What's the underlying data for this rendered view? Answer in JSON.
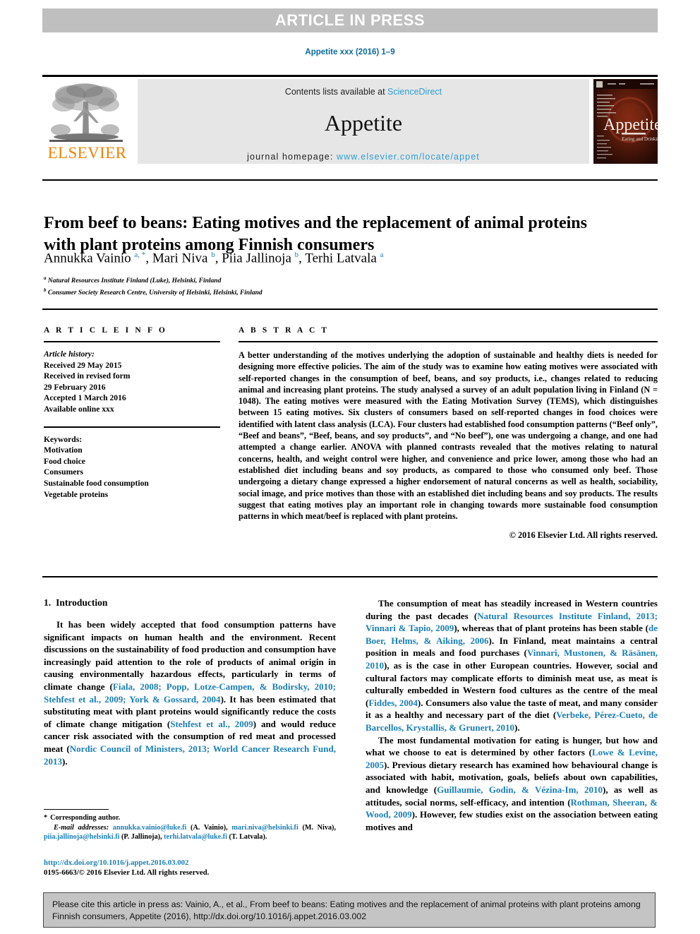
{
  "banner": {
    "label": "ARTICLE IN PRESS"
  },
  "running_head": "Appetite xxx (2016) 1–9",
  "journal_header": {
    "contents_prefix": "Contents lists available at ",
    "sciencedirect": "ScienceDirect",
    "journal_name": "Appetite",
    "homepage_prefix": "journal homepage: ",
    "homepage_url": "www.elsevier.com/locate/appet",
    "publisher": "ELSEVIER",
    "cover_title": "Appetite",
    "cover_subtitle": "Eating and Drinking"
  },
  "article": {
    "title": "From beef to beans: Eating motives and the replacement of animal proteins with plant proteins among Finnish consumers",
    "authors": [
      {
        "name": "Annukka Vainio",
        "marks": "a, *"
      },
      {
        "name": "Mari Niva",
        "marks": "b"
      },
      {
        "name": "Piia Jallinoja",
        "marks": "b"
      },
      {
        "name": "Terhi Latvala",
        "marks": "a"
      }
    ],
    "affiliations": [
      {
        "mark": "a",
        "text": "Natural Resources Institute Finland (Luke), Helsinki, Finland"
      },
      {
        "mark": "b",
        "text": "Consumer Society Research Centre, University of Helsinki, Helsinki, Finland"
      }
    ]
  },
  "article_info": {
    "heading": "A R T I C L E  I N F O",
    "history_label": "Article history:",
    "history": [
      "Received 29 May 2015",
      "Received in revised form",
      "29 February 2016",
      "Accepted 1 March 2016",
      "Available online xxx"
    ],
    "keywords_label": "Keywords:",
    "keywords": [
      "Motivation",
      "Food choice",
      "Consumers",
      "Sustainable food consumption",
      "Vegetable proteins"
    ]
  },
  "abstract": {
    "heading": "A B S T R A C T",
    "text": "A better understanding of the motives underlying the adoption of sustainable and healthy diets is needed for designing more effective policies. The aim of the study was to examine how eating motives were associated with self-reported changes in the consumption of beef, beans, and soy products, i.e., changes related to reducing animal and increasing plant proteins. The study analysed a survey of an adult population living in Finland (N = 1048). The eating motives were measured with the Eating Motivation Survey (TEMS), which distinguishes between 15 eating motives. Six clusters of consumers based on self-reported changes in food choices were identified with latent class analysis (LCA). Four clusters had established food consumption patterns (“Beef only”, “Beef and beans”, “Beef, beans, and soy products”, and “No beef”), one was undergoing a change, and one had attempted a change earlier. ANOVA with planned contrasts revealed that the motives relating to natural concerns, health, and weight control were higher, and convenience and price lower, among those who had an established diet including beans and soy products, as compared to those who consumed only beef. Those undergoing a dietary change expressed a higher endorsement of natural concerns as well as health, sociability, social image, and price motives than those with an established diet including beans and soy products. The results suggest that eating motives play an important role in changing towards more sustainable food consumption patterns in which meat/beef is replaced with plant proteins.",
    "copyright": "© 2016 Elsevier Ltd. All rights reserved."
  },
  "introduction": {
    "number": "1.",
    "heading": "Introduction",
    "left_paragraphs": [
      {
        "segments": [
          {
            "t": "It has been widely accepted that food consumption patterns have significant impacts on human health and the environment. Recent discussions on the sustainability of food production and consumption have increasingly paid attention to the role of products of animal origin in causing environmentally hazardous effects, particularly in terms of climate change (",
            "ref": false
          },
          {
            "t": "Fiala, 2008; Popp, Lotze-Campen, & Bodirsky, 2010; Stehfest et al., 2009; York & Gossard, 2004",
            "ref": true
          },
          {
            "t": "). It has been estimated that substituting meat with plant proteins would significantly reduce the costs of climate change mitigation (",
            "ref": false
          },
          {
            "t": "Stehfest et al., 2009",
            "ref": true
          },
          {
            "t": ") and would reduce cancer risk associated with the consumption of red meat and processed meat (",
            "ref": false
          },
          {
            "t": "Nordic Council of Ministers, 2013; World Cancer Research Fund, 2013",
            "ref": true
          },
          {
            "t": ").",
            "ref": false
          }
        ]
      }
    ],
    "right_paragraphs": [
      {
        "segments": [
          {
            "t": "The consumption of meat has steadily increased in Western countries during the past decades (",
            "ref": false
          },
          {
            "t": "Natural Resources Institute Finland, 2013; Vinnari & Tapio, 2009",
            "ref": true
          },
          {
            "t": "), whereas that of plant proteins has been stable (",
            "ref": false
          },
          {
            "t": "de Boer, Helms, & Aiking, 2006",
            "ref": true
          },
          {
            "t": "). In Finland, meat maintains a central position in meals and food purchases (",
            "ref": false
          },
          {
            "t": "Vinnari, Mustonen, & Räsänen, 2010",
            "ref": true
          },
          {
            "t": "), as is the case in other European countries. However, social and cultural factors may complicate efforts to diminish meat use, as meat is culturally embedded in Western food cultures as the centre of the meal (",
            "ref": false
          },
          {
            "t": "Fiddes, 2004",
            "ref": true
          },
          {
            "t": "). Consumers also value the taste of meat, and many consider it as a healthy and necessary part of the diet (",
            "ref": false
          },
          {
            "t": "Verbeke, Pérez-Cueto, de Barcellos, Krystallis, & Grunert, 2010",
            "ref": true
          },
          {
            "t": ").",
            "ref": false
          }
        ]
      },
      {
        "segments": [
          {
            "t": "The most fundamental motivation for eating is hunger, but how and what we choose to eat is determined by other factors (",
            "ref": false
          },
          {
            "t": "Lowe & Levine, 2005",
            "ref": true
          },
          {
            "t": "). Previous dietary research has examined how behavioural change is associated with habit, motivation, goals, beliefs about own capabilities, and knowledge (",
            "ref": false
          },
          {
            "t": "Guillaumie, Godin, & Vézina-Im, 2010",
            "ref": true
          },
          {
            "t": "), as well as attitudes, social norms, self-efficacy, and intention (",
            "ref": false
          },
          {
            "t": "Rothman, Sheeran, & Wood, 2009",
            "ref": true
          },
          {
            "t": "). However, few studies exist on the association between eating motives and",
            "ref": false
          }
        ]
      }
    ]
  },
  "footnote": {
    "corresponding": "Corresponding author.",
    "email_label": "E-mail addresses:",
    "emails": [
      {
        "address": "annukka.vainio@luke.fi",
        "person": "(A. Vainio),"
      },
      {
        "address": "mari.niva@helsinki.fi",
        "person": "(M. Niva),"
      },
      {
        "address": "piia.jallinoja@helsinki.fi",
        "person": "(P. Jallinoja),"
      },
      {
        "address": "terhi.latvala@luke.fi",
        "person": "(T. Latvala)."
      }
    ]
  },
  "doi": {
    "url": "http://dx.doi.org/10.1016/j.appet.2016.03.002",
    "issn_line": "0195-6663/© 2016 Elsevier Ltd. All rights reserved."
  },
  "cite_box": {
    "text": "Please cite this article in press as: Vainio, A., et al., From beef to beans: Eating motives and the replacement of animal proteins with plant proteins among Finnish consumers, Appetite (2016), http://dx.doi.org/10.1016/j.appet.2016.03.002"
  },
  "colors": {
    "link_blue": "#1a7fb5",
    "sciencedirect_blue": "#2f9fd0",
    "elsevier_orange": "#ef8200",
    "banner_gray": "#bfbfbf",
    "jbox_gray": "#e6e6e6",
    "cite_gray": "#c4c4c4"
  }
}
